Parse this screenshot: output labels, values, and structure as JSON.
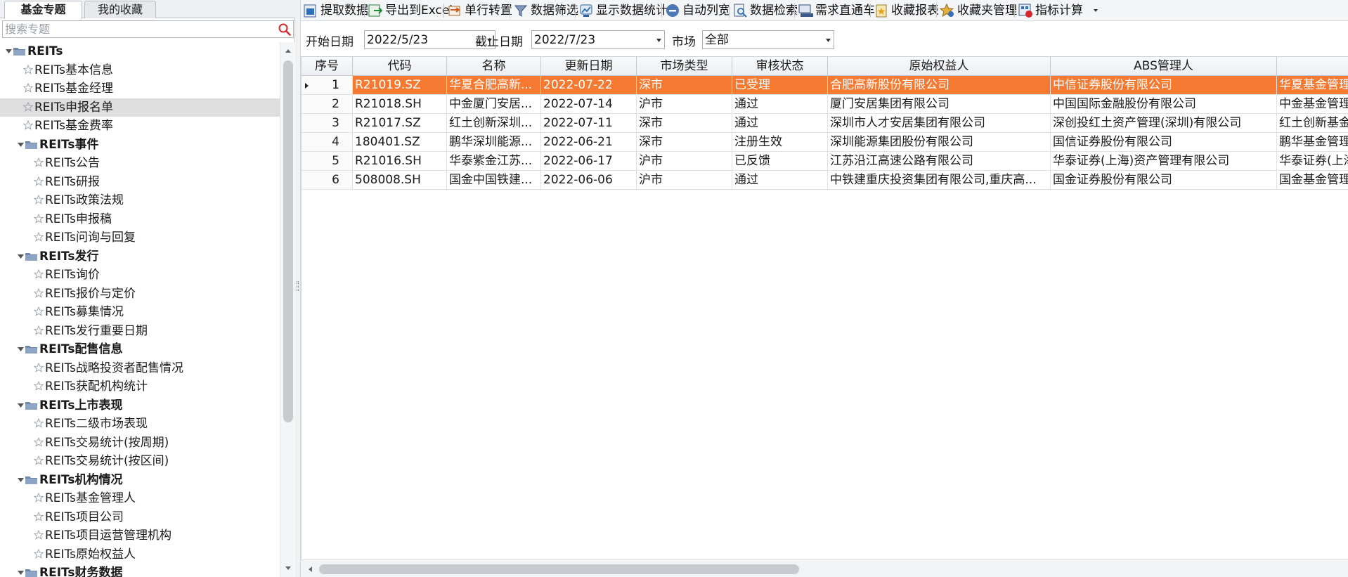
{
  "tabs": [
    {
      "label": "基金专题",
      "active": true
    },
    {
      "label": "我的收藏",
      "active": false
    }
  ],
  "search": {
    "placeholder": "搜索专题",
    "value": ""
  },
  "tree": [
    {
      "kind": "group",
      "level": 0,
      "label": "REITs",
      "expanded": true
    },
    {
      "kind": "item",
      "label": "REITs基本信息"
    },
    {
      "kind": "item",
      "label": "REITs基金经理"
    },
    {
      "kind": "item",
      "label": "REITs申报名单",
      "selected": true
    },
    {
      "kind": "item",
      "label": "REITs基金费率"
    },
    {
      "kind": "group",
      "level": 1,
      "label": "REITs事件",
      "expanded": true
    },
    {
      "kind": "item",
      "level": 1,
      "label": "REITs公告"
    },
    {
      "kind": "item",
      "level": 1,
      "label": "REITs研报"
    },
    {
      "kind": "item",
      "level": 1,
      "label": "REITs政策法规"
    },
    {
      "kind": "item",
      "level": 1,
      "label": "REITs申报稿"
    },
    {
      "kind": "item",
      "level": 1,
      "label": "REITs问询与回复"
    },
    {
      "kind": "group",
      "level": 1,
      "label": "REITs发行",
      "expanded": true
    },
    {
      "kind": "item",
      "level": 1,
      "label": "REITs询价"
    },
    {
      "kind": "item",
      "level": 1,
      "label": "REITs报价与定价"
    },
    {
      "kind": "item",
      "level": 1,
      "label": "REITs募集情况"
    },
    {
      "kind": "item",
      "level": 1,
      "label": "REITs发行重要日期"
    },
    {
      "kind": "group",
      "level": 1,
      "label": "REITs配售信息",
      "expanded": true
    },
    {
      "kind": "item",
      "level": 1,
      "label": "REITs战略投资者配售情况"
    },
    {
      "kind": "item",
      "level": 1,
      "label": "REITs获配机构统计"
    },
    {
      "kind": "group",
      "level": 1,
      "label": "REITs上市表现",
      "expanded": true
    },
    {
      "kind": "item",
      "level": 1,
      "label": "REITs二级市场表现"
    },
    {
      "kind": "item",
      "level": 1,
      "label": "REITs交易统计(按周期)"
    },
    {
      "kind": "item",
      "level": 1,
      "label": "REITs交易统计(按区间)"
    },
    {
      "kind": "group",
      "level": 1,
      "label": "REITs机构情况",
      "expanded": true
    },
    {
      "kind": "item",
      "level": 1,
      "label": "REITs基金管理人"
    },
    {
      "kind": "item",
      "level": 1,
      "label": "REITs项目公司"
    },
    {
      "kind": "item",
      "level": 1,
      "label": "REITs项目运营管理机构"
    },
    {
      "kind": "item",
      "level": 1,
      "label": "REITs原始权益人"
    },
    {
      "kind": "group",
      "level": 1,
      "label": "REITs财务数据",
      "expanded": true
    }
  ],
  "toolbar": [
    {
      "label": "提取数据",
      "icon": "extract-data-icon"
    },
    {
      "label": "导出到Excel",
      "icon": "export-excel-icon"
    },
    {
      "label": "单行转置",
      "icon": "transpose-icon"
    },
    {
      "label": "数据筛选",
      "icon": "filter-icon"
    },
    {
      "label": "显示数据统计",
      "icon": "statistics-icon"
    },
    {
      "label": "自动列宽",
      "icon": "auto-width-icon"
    },
    {
      "label": "数据检索",
      "icon": "data-search-icon"
    },
    {
      "label": "需求直通车",
      "icon": "request-icon"
    },
    {
      "label": "收藏报表",
      "icon": "favorite-report-icon"
    },
    {
      "label": "收藏夹管理",
      "icon": "favorites-manage-icon"
    },
    {
      "label": "指标计算",
      "icon": "indicator-calc-icon",
      "dropdown": true
    }
  ],
  "filters": {
    "start_label": "开始日期",
    "start_value": "2022/5/23",
    "end_label": "截止日期",
    "end_value": "2022/7/23",
    "market_label": "市场",
    "market_value": "全部"
  },
  "table": {
    "columns": [
      "序号",
      "代码",
      "名称",
      "更新日期",
      "市场类型",
      "审核状态",
      "原始权益人",
      "ABS管理人",
      ""
    ],
    "rows": [
      [
        "1",
        "R21019.SZ",
        "华夏合肥高新...",
        "2022-07-22",
        "深市",
        "已受理",
        "合肥高新股份有限公司",
        "中信证券股份有限公司",
        "华夏基金管理"
      ],
      [
        "2",
        "R21018.SH",
        "中金厦门安居...",
        "2022-07-14",
        "沪市",
        "通过",
        "厦门安居集团有限公司",
        "中国国际金融股份有限公司",
        "中金基金管理"
      ],
      [
        "3",
        "R21017.SZ",
        "红土创新深圳...",
        "2022-07-11",
        "深市",
        "通过",
        "深圳市人才安居集团有限公司",
        "深创投红土资产管理(深圳)有限公司",
        "红土创新基金"
      ],
      [
        "4",
        "180401.SZ",
        "鹏华深圳能源...",
        "2022-06-21",
        "深市",
        "注册生效",
        "深圳能源集团股份有限公司",
        "国信证券股份有限公司",
        "鹏华基金管理"
      ],
      [
        "5",
        "R21016.SH",
        "华泰紫金江苏...",
        "2022-06-17",
        "沪市",
        "已反馈",
        "江苏沿江高速公路有限公司",
        "华泰证券(上海)资产管理有限公司",
        "华泰证券(上海"
      ],
      [
        "6",
        "508008.SH",
        "国金中国铁建...",
        "2022-06-06",
        "沪市",
        "通过",
        "中铁建重庆投资集团有限公司,重庆高...",
        "国金证券股份有限公司",
        "国金基金管理"
      ]
    ],
    "selected_row": 0
  },
  "colors": {
    "selection": "#f57931",
    "accent_blue": "#2f6fb8"
  }
}
